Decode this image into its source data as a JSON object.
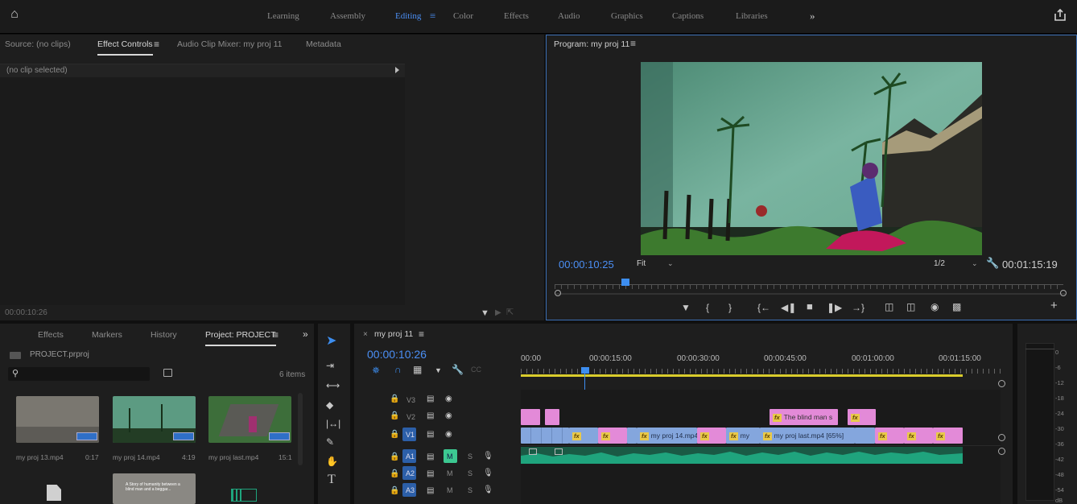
{
  "workspaces": [
    "Learning",
    "Assembly",
    "Editing",
    "Color",
    "Effects",
    "Audio",
    "Graphics",
    "Captions",
    "Libraries"
  ],
  "workspace_more": "»",
  "workspace_active_index": 2,
  "workspace_menu_glyph": "≡",
  "source_panel": {
    "tabs": [
      "Source: (no clips)",
      "Effect Controls",
      "Audio Clip Mixer: my proj 11",
      "Metadata"
    ],
    "active_tab_index": 1,
    "menu_glyph": "≡",
    "no_clip_text": "(no clip selected)",
    "timecode": "00:00:10:26"
  },
  "program": {
    "title": "Program: my proj 11",
    "menu_glyph": "≡",
    "timecode": "00:00:10:25",
    "fit_label": "Fit",
    "resolution": "1/2",
    "duration": "00:01:15:19",
    "playhead_fraction": 0.14
  },
  "project_panel": {
    "tabs": [
      "Effects",
      "Markers",
      "History",
      "Project: PROJECT"
    ],
    "active_tab_index": 3,
    "menu_glyph": "≡",
    "more": "»",
    "project_file": "PROJECT.prproj",
    "item_count": "6 items",
    "items": [
      {
        "name": "my proj 13.mp4",
        "duration": "0:17"
      },
      {
        "name": "my proj 14.mp4",
        "duration": "4:19"
      },
      {
        "name": "my proj last.mp4",
        "duration": "15:1"
      }
    ],
    "title_thumb_text": "A Story of humanity between a blind man and a beggar..."
  },
  "timeline": {
    "sequence": "my proj 11",
    "menu_glyph": "≡",
    "close_glyph": "×",
    "timecode": "00:00:10:26",
    "ruler": [
      "00:00",
      "00:00:15:00",
      "00:00:30:00",
      "00:00:45:00",
      "00:01:00:00",
      "00:01:15:00"
    ],
    "video_tracks": [
      "V3",
      "V2",
      "V1"
    ],
    "audio_tracks": [
      "A1",
      "A2",
      "A3"
    ],
    "track_buttons": {
      "mute": "M",
      "solo": "S"
    },
    "v2_clip": "The blind man s",
    "v1_clips": [
      "my proj 14.mp4",
      "my",
      "my proj last.mp4 [65%]"
    ],
    "fx_badge": "fx"
  },
  "meter_scale": [
    "0",
    "-6",
    "-12",
    "-18",
    "-24",
    "-30",
    "-36",
    "-42",
    "-48",
    "-54",
    "dB"
  ],
  "colors": {
    "accent": "#3d8ef0",
    "clip_pink": "#e38ad8",
    "clip_blue": "#84a6dd",
    "audio_green": "#1fa47d",
    "work_area": "#d9cc2c"
  }
}
